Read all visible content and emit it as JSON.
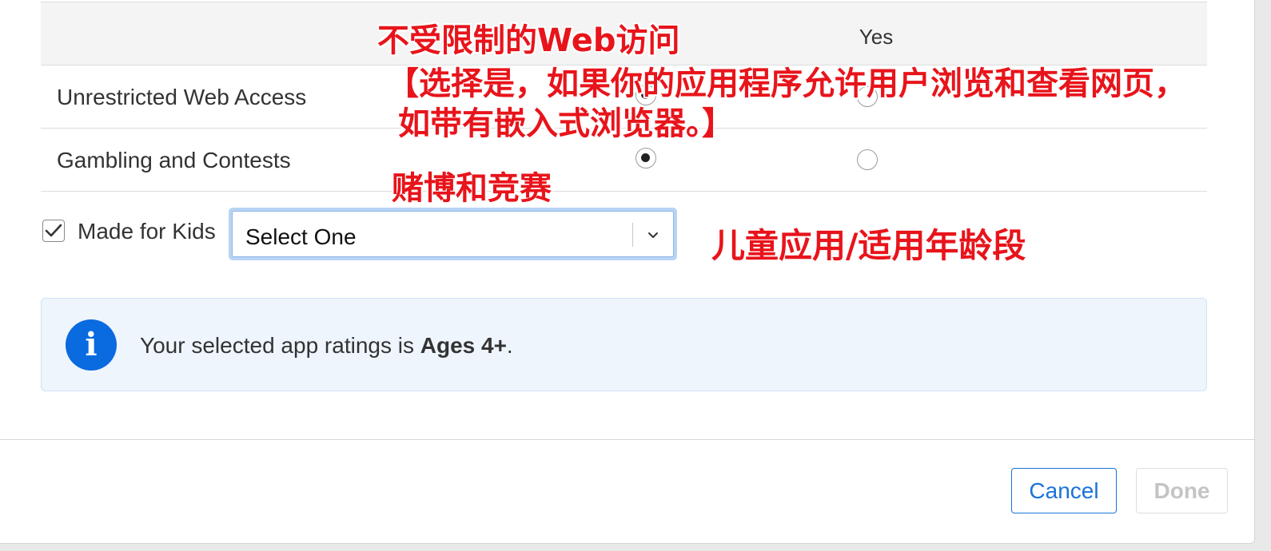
{
  "table": {
    "yes_header": "Yes",
    "rows": [
      {
        "label": "Unrestricted Web Access",
        "selected": "no"
      },
      {
        "label": "Gambling and Contests",
        "selected": "no"
      }
    ]
  },
  "kids": {
    "label": "Made for Kids",
    "checked": true,
    "select_value": "Select One"
  },
  "info": {
    "text_prefix": "Your selected app ratings is ",
    "rating": "Ages 4+",
    "text_suffix": ".",
    "icon": "info-icon"
  },
  "footer": {
    "cancel_label": "Cancel",
    "done_label": "Done"
  },
  "annotations": {
    "web_title": "不受限制的Web访问",
    "web_line1": "【选择是，如果你的应用程序允许用户浏览和查看网页，",
    "web_line2": "如带有嵌入式浏览器。】",
    "gambling": "赌博和竞赛",
    "kids": "儿童应用/适用年龄段"
  },
  "colors": {
    "accent": "#1a73d9",
    "info_icon": "#0a6ae0",
    "annotation": "#e8141b"
  }
}
